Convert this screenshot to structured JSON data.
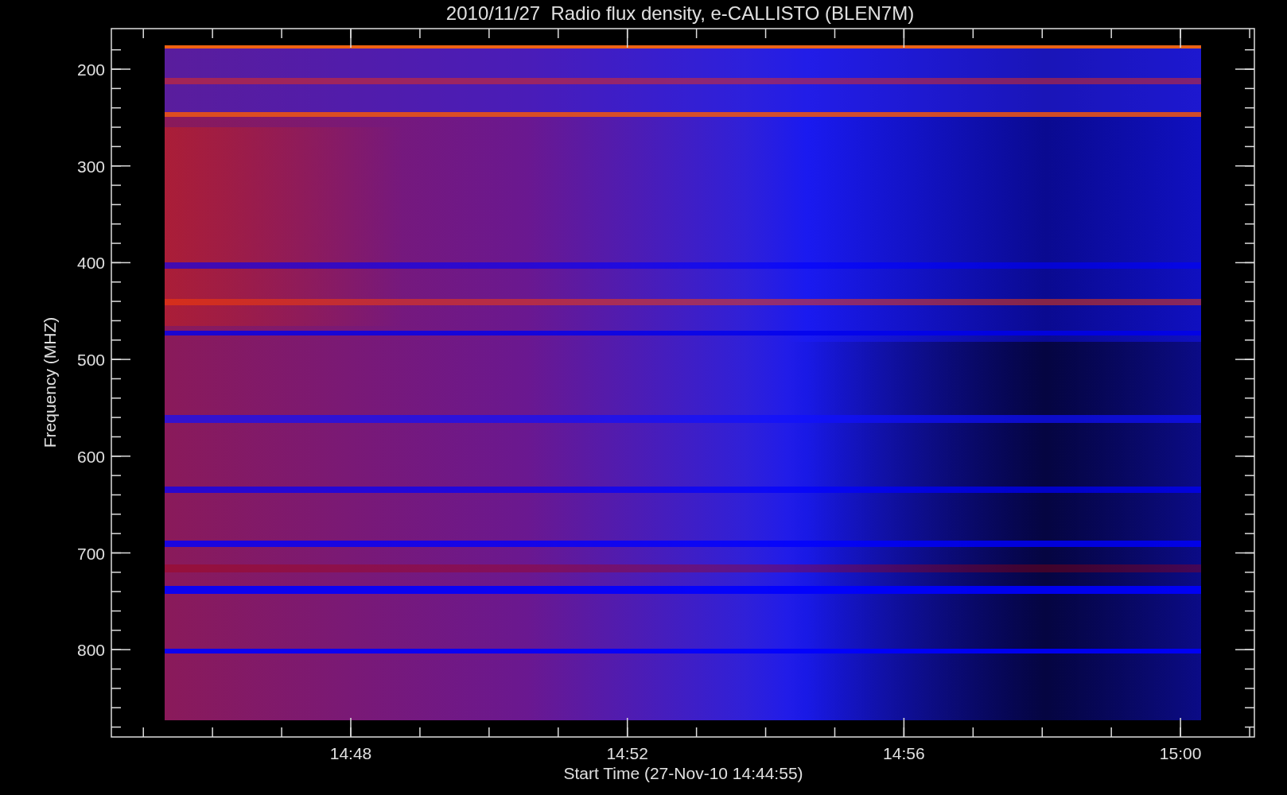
{
  "title": "2010/11/27  Radio flux density, e-CALLISTO (BLEN7M)",
  "y_axis": {
    "label": "Frequency (MHZ)",
    "tick_labels": [
      "200",
      "300",
      "400",
      "500",
      "600",
      "700",
      "800"
    ]
  },
  "x_axis": {
    "label": "Start Time (27-Nov-10 14:44:55)",
    "tick_labels": [
      "14:48",
      "14:52",
      "14:56",
      "15:00"
    ]
  }
}
